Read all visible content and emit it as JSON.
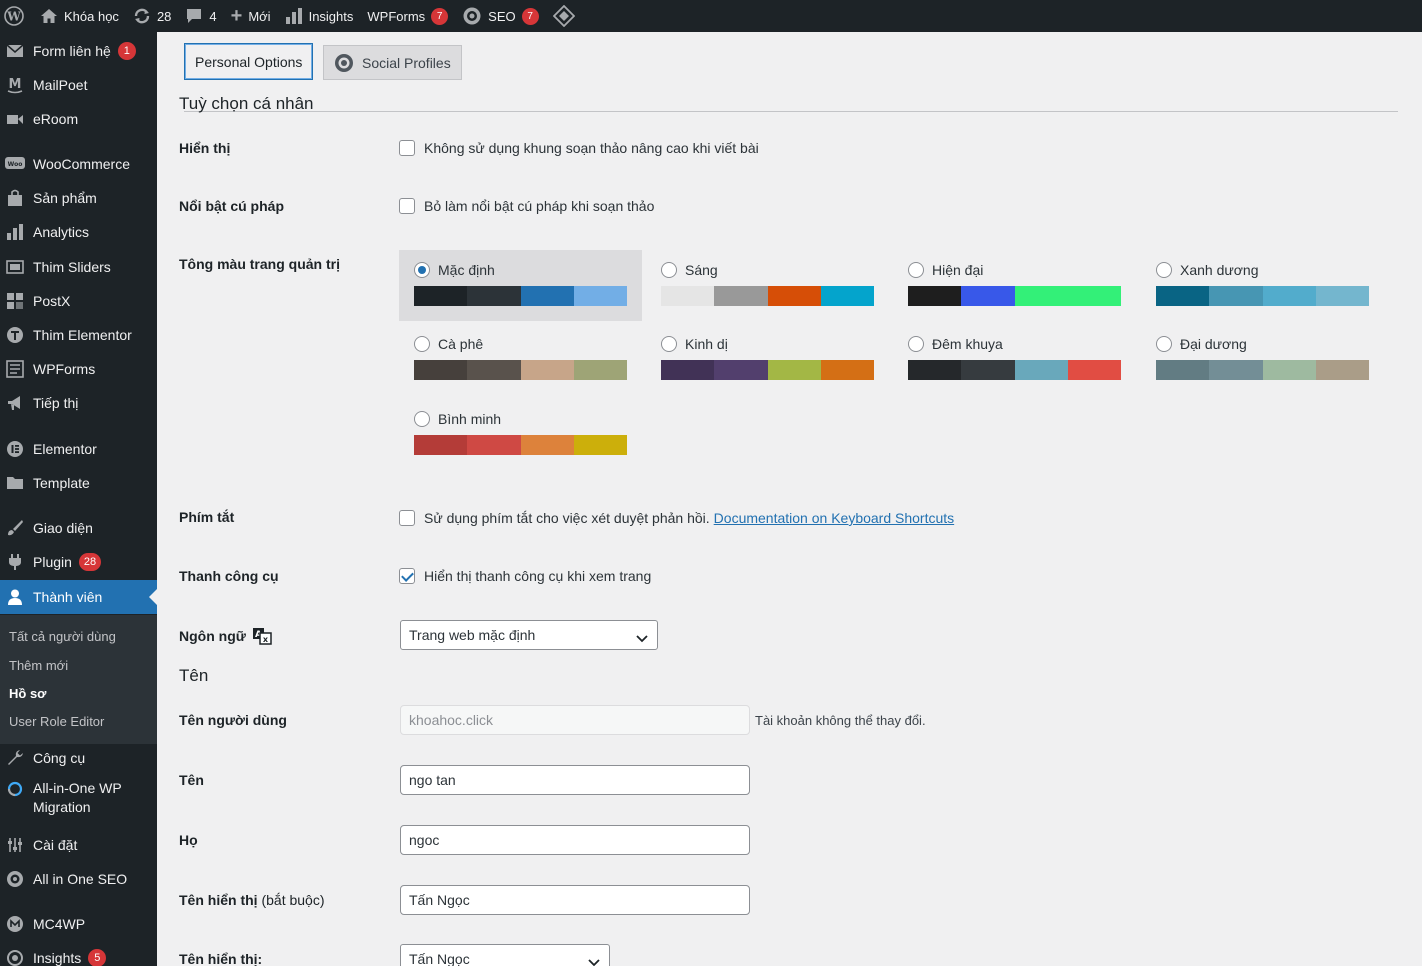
{
  "adminbar": {
    "site_name": "Khóa học",
    "updates_count": "28",
    "comments_count": "4",
    "new_label": "Mới",
    "insights_label": "Insights",
    "wpforms_label": "WPForms",
    "wpforms_badge": "7",
    "seo_label": "SEO",
    "seo_badge": "7"
  },
  "sidebar": {
    "items": [
      {
        "label": "Form liên hệ",
        "badge": "1",
        "icon": "mail-icon"
      },
      {
        "label": "MailPoet",
        "icon": "mailpoet-icon"
      },
      {
        "label": "eRoom",
        "icon": "video-icon"
      },
      {
        "label": "WooCommerce",
        "icon": "woo-icon"
      },
      {
        "label": "Sản phẩm",
        "icon": "product-icon"
      },
      {
        "label": "Analytics",
        "icon": "bar-chart-icon"
      },
      {
        "label": "Thim Sliders",
        "icon": "slider-icon"
      },
      {
        "label": "PostX",
        "icon": "postx-icon"
      },
      {
        "label": "Thim Elementor",
        "icon": "thim-icon"
      },
      {
        "label": "WPForms",
        "icon": "form-icon"
      },
      {
        "label": "Tiếp thị",
        "icon": "megaphone-icon"
      },
      {
        "label": "Elementor",
        "icon": "elementor-icon"
      },
      {
        "label": "Template",
        "icon": "folder-icon"
      },
      {
        "label": "Giao diện",
        "icon": "brush-icon"
      },
      {
        "label": "Plugin",
        "badge": "28",
        "icon": "plugin-icon"
      },
      {
        "label": "Thành viên",
        "icon": "user-icon"
      },
      {
        "label": "Công cụ",
        "icon": "wrench-icon"
      },
      {
        "label": "All-in-One WP Migration",
        "icon": "migration-icon"
      },
      {
        "label": "Cài đặt",
        "icon": "settings-icon"
      },
      {
        "label": "All in One SEO",
        "icon": "seo-icon"
      },
      {
        "label": "MC4WP",
        "icon": "mc4wp-icon"
      },
      {
        "label": "Insights",
        "badge": "5",
        "icon": "insights-icon"
      }
    ],
    "submenu": [
      "Tất cả người dùng",
      "Thêm mới",
      "Hồ sơ",
      "User Role Editor"
    ]
  },
  "tabs": {
    "personal": "Personal Options",
    "social": "Social Profiles"
  },
  "personal_section": {
    "heading": "Tuỳ chọn cá nhân",
    "visual_label": "Hiển thị",
    "visual_checkbox": "Không sử dụng khung soạn thảo nâng cao khi viết bài",
    "syntax_label": "Nổi bật cú pháp",
    "syntax_checkbox": "Bỏ làm nổi bật cú pháp khi soạn thảo",
    "color_label": "Tông màu trang quản trị",
    "color_schemes": [
      {
        "name": "Mặc định",
        "selected": true,
        "colors": [
          "#1d2327",
          "#2c3338",
          "#2271b1",
          "#72aee6"
        ]
      },
      {
        "name": "Sáng",
        "selected": false,
        "colors": [
          "#e5e5e5",
          "#999999",
          "#d64e07",
          "#04a4cc"
        ]
      },
      {
        "name": "Hiện đại",
        "selected": false,
        "colors": [
          "#1e1e1e",
          "#3858e9",
          "#33f078",
          "#33f078"
        ]
      },
      {
        "name": "Xanh dương",
        "selected": false,
        "colors": [
          "#096484",
          "#4796b3",
          "#52accc",
          "#74b6ce"
        ]
      },
      {
        "name": "Cà phê",
        "selected": false,
        "colors": [
          "#46403c",
          "#59524c",
          "#c7a589",
          "#9ea476"
        ]
      },
      {
        "name": "Kinh dị",
        "selected": false,
        "colors": [
          "#413256",
          "#523f6d",
          "#a3b745",
          "#d46f15"
        ]
      },
      {
        "name": "Đêm khuya",
        "selected": false,
        "colors": [
          "#25282b",
          "#363b3f",
          "#69a8bb",
          "#e14d43"
        ]
      },
      {
        "name": "Đại dương",
        "selected": false,
        "colors": [
          "#627c83",
          "#738e96",
          "#9ebaa0",
          "#aa9d88"
        ]
      },
      {
        "name": "Bình minh",
        "selected": false,
        "colors": [
          "#b43c38",
          "#cf4944",
          "#dd823b",
          "#ccaf0b"
        ]
      }
    ],
    "shortcuts_label": "Phím tắt",
    "shortcuts_checkbox": "Sử dụng phím tắt cho việc xét duyệt phản hồi.",
    "shortcuts_link": "Documentation on Keyboard Shortcuts",
    "toolbar_label": "Thanh công cụ",
    "toolbar_checkbox": "Hiển thị thanh công cụ khi xem trang",
    "toolbar_checked": true,
    "language_label": "Ngôn ngữ",
    "language_value": "Trang web mặc định"
  },
  "name_section": {
    "heading": "Tên",
    "username_label": "Tên người dùng",
    "username_value": "khoahoc.click",
    "username_note": "Tài khoản không thể thay đổi.",
    "first_name_label": "Tên",
    "first_name_value": "ngo tan",
    "last_name_label": "Họ",
    "last_name_value": "ngoc",
    "nickname_label": "Tên hiển thị",
    "nickname_required": "(bắt buộc)",
    "nickname_value": "Tấn Ngọc",
    "display_label": "Tên hiển thị:",
    "display_value": "Tấn Ngọc"
  }
}
